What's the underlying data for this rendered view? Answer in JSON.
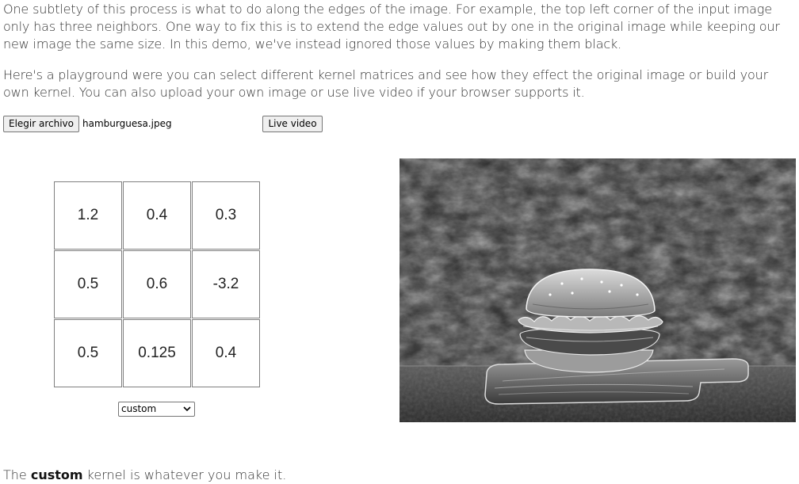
{
  "intro": {
    "paragraph_1": "One subtlety of this process is what to do along the edges of the image. For example, the top left corner of the input image only has three neighbors. One way to fix this is to extend the edge values out by one in the original image while keeping our new image the same size. In this demo, we've instead ignored those values by making them black.",
    "paragraph_2": "Here's a playground were you can select different kernel matrices and see how they effect the original image or build your own kernel. You can also upload your own image or use live video if your browser supports it."
  },
  "controls": {
    "file_button_label": "Elegir archivo",
    "file_name": "hamburguesa.jpeg",
    "live_video_label": "Live video"
  },
  "kernel": {
    "cells": [
      "1.2",
      "0.4",
      "0.3",
      "0.5",
      "0.6",
      "-3.2",
      "0.5",
      "0.125",
      "0.4"
    ],
    "selected_kernel": "custom"
  },
  "footer": {
    "prefix": "The ",
    "kernel_name": "custom",
    "suffix": " kernel is whatever you make it."
  }
}
